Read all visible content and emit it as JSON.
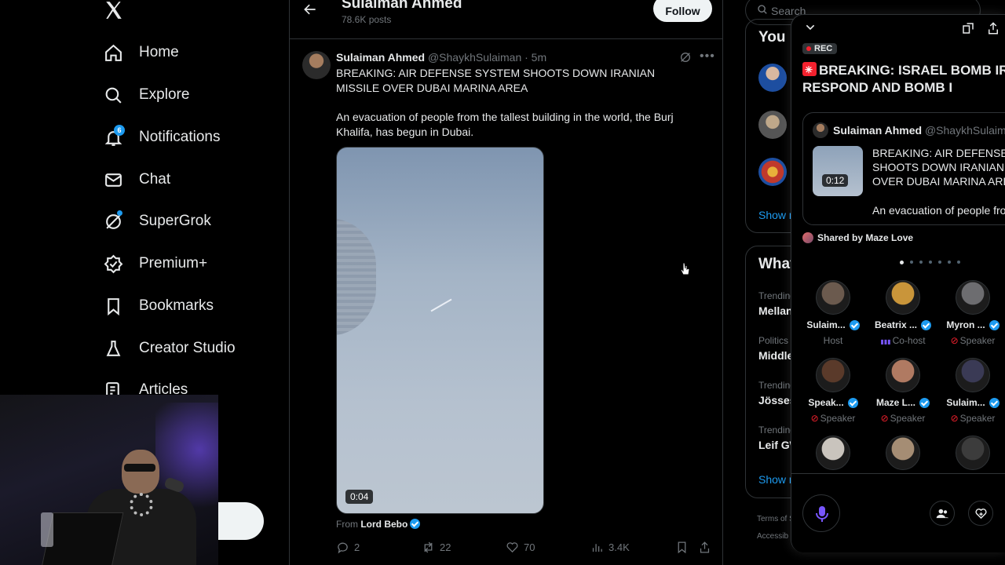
{
  "nav": {
    "items": [
      {
        "label": "Home",
        "icon": "home-icon"
      },
      {
        "label": "Explore",
        "icon": "search-icon"
      },
      {
        "label": "Notifications",
        "icon": "bell-icon",
        "badge": "6"
      },
      {
        "label": "Chat",
        "icon": "mail-icon"
      },
      {
        "label": "SuperGrok",
        "icon": "grok-icon"
      },
      {
        "label": "Premium+",
        "icon": "verified-icon"
      },
      {
        "label": "Bookmarks",
        "icon": "bookmark-icon"
      },
      {
        "label": "Creator Studio",
        "icon": "flask-icon"
      },
      {
        "label": "Articles",
        "icon": "article-icon"
      }
    ]
  },
  "profile_header": {
    "name": "Sulaiman Ahmed",
    "posts": "78.6K posts",
    "follow_label": "Follow"
  },
  "tweet": {
    "name": "Sulaiman Ahmed",
    "handle": "@ShaykhSulaiman",
    "time": "· 5m",
    "text1": "BREAKING: AIR DEFENSE SYSTEM SHOOTS DOWN IRANIAN MISSILE OVER DUBAI MARINA AREA",
    "text2": "An evacuation of people from the tallest building in the world, the Burj Khalifa, has begun in Dubai.",
    "video_duration": "0:04",
    "from_prefix": "From",
    "from_account": "Lord Bebo",
    "replies": "2",
    "reposts": "22",
    "likes": "70",
    "views": "3.4K"
  },
  "right": {
    "search_placeholder": "Search",
    "you_might_like_title": "You m",
    "show_more_1": "Show m",
    "whats_happening_title": "What",
    "trends": [
      {
        "category": "Trending",
        "name": "Mellan"
      },
      {
        "category": "Politics",
        "name": "Middle"
      },
      {
        "category": "Trending",
        "name": "Jösses"
      },
      {
        "category": "Trending",
        "name": "Leif GW"
      }
    ],
    "show_more_2": "Show m",
    "footer_1": "Terms of S",
    "footer_2": "Accessib"
  },
  "space": {
    "rec_label": "REC",
    "title": "BREAKING: ISRAEL BOMB IRAN RESPOND AND BOMB I",
    "pinned": {
      "name": "Sulaiman Ahmed",
      "handle": "@ShaykhSulaiman",
      "duration": "0:12",
      "text": "BREAKING: AIR DEFENSE S SHOOTS DOWN IRANIAN M OVER DUBAI MARINA AREA",
      "text2": "An evacuation of people fro"
    },
    "shared_by": "Shared by Maze Love",
    "participants": [
      {
        "name": "Sulaim...",
        "role": "Host",
        "role_icon": "none",
        "color": "#6b5a4e"
      },
      {
        "name": "Beatrix ...",
        "role": "Co-host",
        "role_icon": "audio-bars-icon",
        "color": "#c9953a"
      },
      {
        "name": "Myron ...",
        "role": "Speaker",
        "role_icon": "mic-muted-icon",
        "color": "#6d6d70"
      },
      {
        "name": "Speak...",
        "role": "Speaker",
        "role_icon": "mic-muted-icon",
        "color": "#5a3a2a"
      },
      {
        "name": "Maze L...",
        "role": "Speaker",
        "role_icon": "mic-muted-icon",
        "color": "#b07a62"
      },
      {
        "name": "Sulaim...",
        "role": "Speaker",
        "role_icon": "mic-muted-icon",
        "color": "#3a3a55"
      },
      {
        "name": "",
        "role": "",
        "role_icon": "none",
        "color": "#c9c4bd"
      },
      {
        "name": "",
        "role": "",
        "role_icon": "none",
        "color": "#a58d74"
      },
      {
        "name": "",
        "role": "",
        "role_icon": "none",
        "color": "#3c3c3c"
      }
    ]
  },
  "colors": {
    "accent": "#1d9bf0",
    "rec_red": "#f4212e",
    "cohost_purple": "#7856ff"
  }
}
